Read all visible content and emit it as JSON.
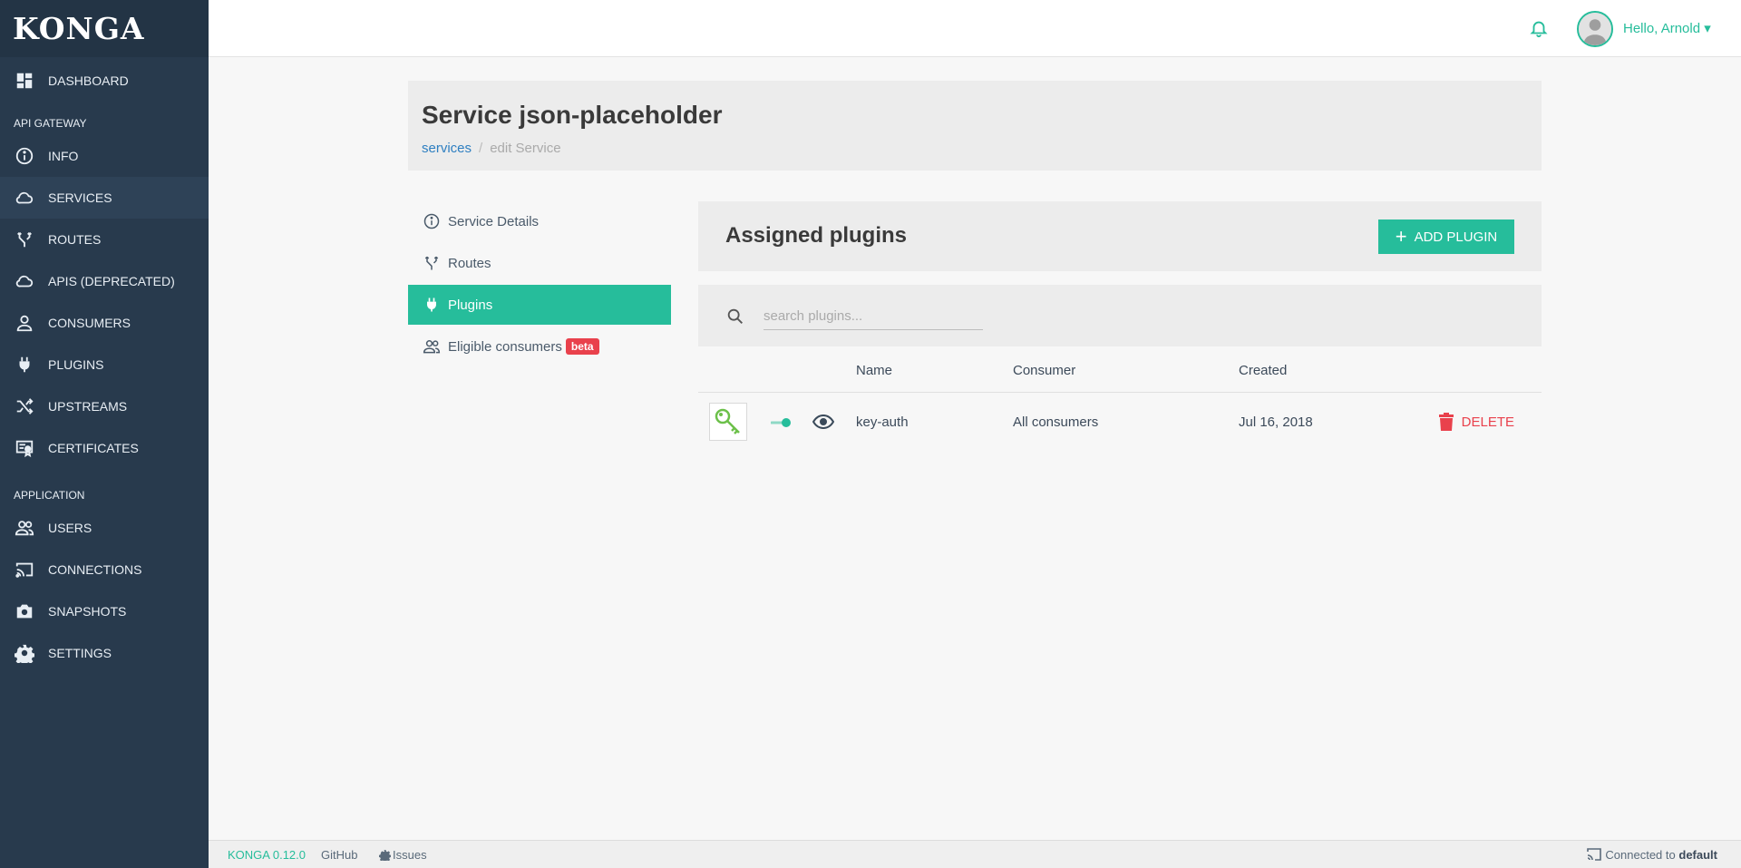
{
  "app": {
    "logo": "KONGA"
  },
  "sidebar": {
    "dashboard": "DASHBOARD",
    "section_api": "API GATEWAY",
    "api_items": [
      {
        "label": "INFO",
        "icon": "info-icon"
      },
      {
        "label": "SERVICES",
        "icon": "cloud-icon"
      },
      {
        "label": "ROUTES",
        "icon": "fork-icon"
      },
      {
        "label": "APIS (DEPRECATED)",
        "icon": "cloud-icon"
      },
      {
        "label": "CONSUMERS",
        "icon": "user-icon"
      },
      {
        "label": "PLUGINS",
        "icon": "plug-icon"
      },
      {
        "label": "UPSTREAMS",
        "icon": "shuffle-icon"
      },
      {
        "label": "CERTIFICATES",
        "icon": "certificate-icon"
      }
    ],
    "section_app": "APPLICATION",
    "app_items": [
      {
        "label": "USERS",
        "icon": "users-icon"
      },
      {
        "label": "CONNECTIONS",
        "icon": "cast-icon"
      },
      {
        "label": "SNAPSHOTS",
        "icon": "camera-icon"
      },
      {
        "label": "SETTINGS",
        "icon": "gear-icon"
      }
    ],
    "active": "SERVICES"
  },
  "topbar": {
    "greeting": "Hello, Arnold"
  },
  "header": {
    "title": "Service json-placeholder",
    "breadcrumb_link": "services",
    "breadcrumb_sep": "/",
    "breadcrumb_current": "edit Service"
  },
  "side_menu": {
    "service_details": "Service Details",
    "routes": "Routes",
    "plugins": "Plugins",
    "eligible_consumers": "Eligible consumers",
    "beta_badge": "beta"
  },
  "plugins_panel": {
    "title": "Assigned plugins",
    "add_button": "ADD PLUGIN",
    "search_placeholder": "search plugins...",
    "columns": {
      "name": "Name",
      "consumer": "Consumer",
      "created": "Created"
    },
    "rows": [
      {
        "name": "key-auth",
        "consumer": "All consumers",
        "created": "Jul 16, 2018",
        "delete_label": "DELETE",
        "enabled": true
      }
    ]
  },
  "footer": {
    "version": "KONGA 0.12.0",
    "github": "GitHub",
    "issues": "Issues",
    "connected_prefix": "Connected to",
    "connection": "default"
  },
  "colors": {
    "accent": "#26bd9b",
    "sidebar": "#283a4d",
    "danger": "#e9414c",
    "link": "#2e7fc1"
  }
}
